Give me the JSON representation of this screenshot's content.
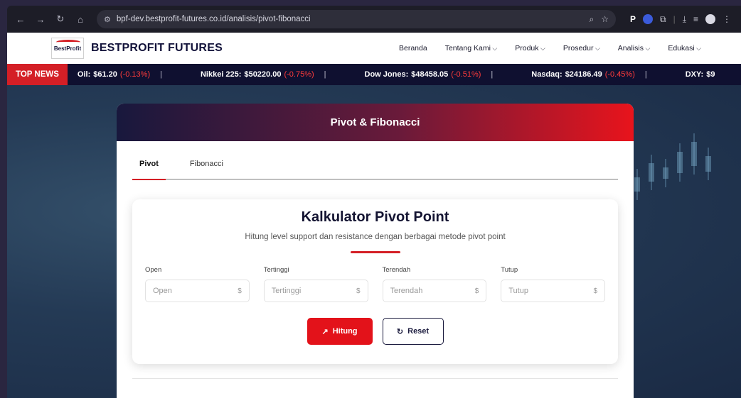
{
  "browser": {
    "url": "bpf-dev.bestprofit-futures.co.id/analisis/pivot-fibonacci"
  },
  "header": {
    "logo_text": "BestProfit",
    "brand": "BESTPROFIT FUTURES",
    "nav": [
      {
        "label": "Beranda",
        "dropdown": false
      },
      {
        "label": "Tentang Kami",
        "dropdown": true
      },
      {
        "label": "Produk",
        "dropdown": true
      },
      {
        "label": "Prosedur",
        "dropdown": true
      },
      {
        "label": "Analisis",
        "dropdown": true
      },
      {
        "label": "Edukasi",
        "dropdown": true
      }
    ]
  },
  "ticker": {
    "label": "TOP NEWS",
    "items": [
      {
        "name": "Oil:",
        "value": "$61.20",
        "change": "(-0.13%)"
      },
      {
        "name": "Nikkei 225:",
        "value": "$50220.00",
        "change": "(-0.75%)"
      },
      {
        "name": "Dow Jones:",
        "value": "$48458.05",
        "change": "(-0.51%)"
      },
      {
        "name": "Nasdaq:",
        "value": "$24186.49",
        "change": "(-0.45%)"
      },
      {
        "name": "DXY:",
        "value": "$9",
        "change": ""
      }
    ],
    "separator": "|"
  },
  "card": {
    "title": "Pivot & Fibonacci",
    "tabs": [
      "Pivot",
      "Fibonacci"
    ],
    "active_tab": "Pivot",
    "calculator": {
      "title": "Kalkulator Pivot Point",
      "subtitle": "Hitung level support dan resistance dengan berbagai metode pivot point",
      "fields": [
        {
          "label": "Open",
          "placeholder": "Open",
          "value": "",
          "unit": "$"
        },
        {
          "label": "Tertinggi",
          "placeholder": "Tertinggi",
          "value": "",
          "unit": "$"
        },
        {
          "label": "Terendah",
          "placeholder": "Terendah",
          "value": "",
          "unit": "$"
        },
        {
          "label": "Tutup",
          "placeholder": "Tutup",
          "value": "",
          "unit": "$"
        }
      ],
      "calculate_label": "Hitung",
      "reset_label": "Reset"
    }
  },
  "colors": {
    "accent": "#e3121a",
    "navy": "#12123a",
    "ticker_negative": "#ff3b3b"
  }
}
